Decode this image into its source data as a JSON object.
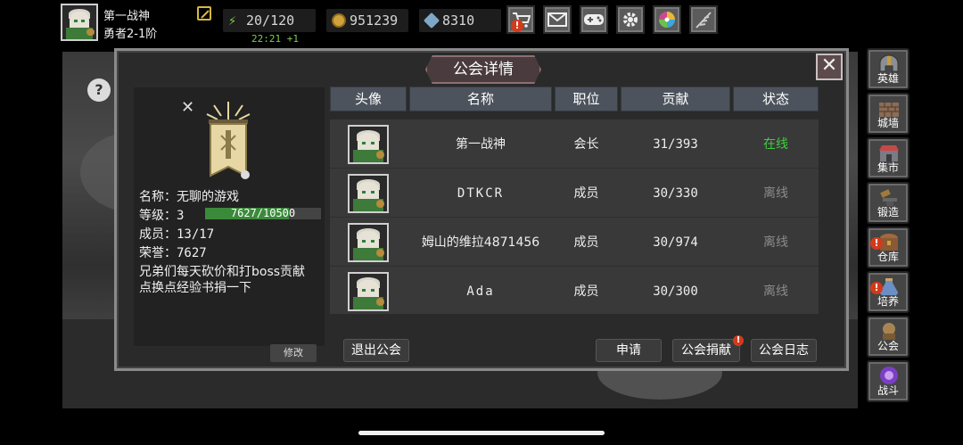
{
  "player": {
    "name": "第一战神",
    "rank": "勇者2-1阶"
  },
  "resources": {
    "stamina": "20/120",
    "stamina_timer": "22:21 +1",
    "gold": "951239",
    "gems": "8310"
  },
  "top_buttons": [
    {
      "name": "shop",
      "icon": "cart-icon",
      "badge": "!"
    },
    {
      "name": "mail",
      "icon": "mail-icon"
    },
    {
      "name": "gamepad",
      "icon": "gamepad-icon"
    },
    {
      "name": "settings",
      "icon": "gear-icon"
    },
    {
      "name": "lottery",
      "icon": "wheel-icon"
    },
    {
      "name": "feather",
      "icon": "feather-icon"
    }
  ],
  "sidebar": {
    "items": [
      {
        "label": "英雄",
        "icon": "helmet-icon"
      },
      {
        "label": "城墙",
        "icon": "wall-icon"
      },
      {
        "label": "集市",
        "icon": "market-icon"
      },
      {
        "label": "锻造",
        "icon": "anvil-icon"
      },
      {
        "label": "仓库",
        "icon": "chest-icon",
        "badge": "!"
      },
      {
        "label": "培养",
        "icon": "potion-icon",
        "badge": "!"
      },
      {
        "label": "公会",
        "icon": "guild-icon"
      },
      {
        "label": "战斗",
        "icon": "portal-icon"
      }
    ]
  },
  "modal": {
    "title": "公会详情",
    "close": "✕"
  },
  "guild": {
    "name_label": "名称：",
    "name": "无聊的游戏",
    "level_label": "等级：",
    "level": "3",
    "exp": "7627/10500",
    "exp_fraction": 0.726,
    "members_label": "成员：",
    "members": "13/17",
    "honor_label": "荣誉：",
    "honor": "7627",
    "notice": "兄弟们每天砍价和打boss贡献点换点经验书捐一下",
    "edit_label": "修改",
    "help": "?",
    "close_x": "✕"
  },
  "table": {
    "headers": [
      "头像",
      "名称",
      "职位",
      "贡献",
      "状态"
    ],
    "rows": [
      {
        "name": "第一战神",
        "role": "会长",
        "contribution": "31/393",
        "status": "在线",
        "online": true
      },
      {
        "name": "DTKCR",
        "role": "成员",
        "contribution": "30/330",
        "status": "离线",
        "online": false
      },
      {
        "name": "姆山的维拉4871456",
        "role": "成员",
        "contribution": "30/974",
        "status": "离线",
        "online": false
      },
      {
        "name": "Ada",
        "role": "成员",
        "contribution": "30/300",
        "status": "离线",
        "online": false
      }
    ]
  },
  "buttons": {
    "leave": "退出公会",
    "apply": "申请",
    "donate": "公会捐献",
    "donate_badge": "!",
    "log": "公会日志"
  },
  "colors": {
    "online": "#3ecf3e",
    "offline": "#8b8b8b",
    "exp_bar": "#3b8a3b",
    "header_bg": "#4c535c",
    "title_bg": "#4a3b3e"
  }
}
